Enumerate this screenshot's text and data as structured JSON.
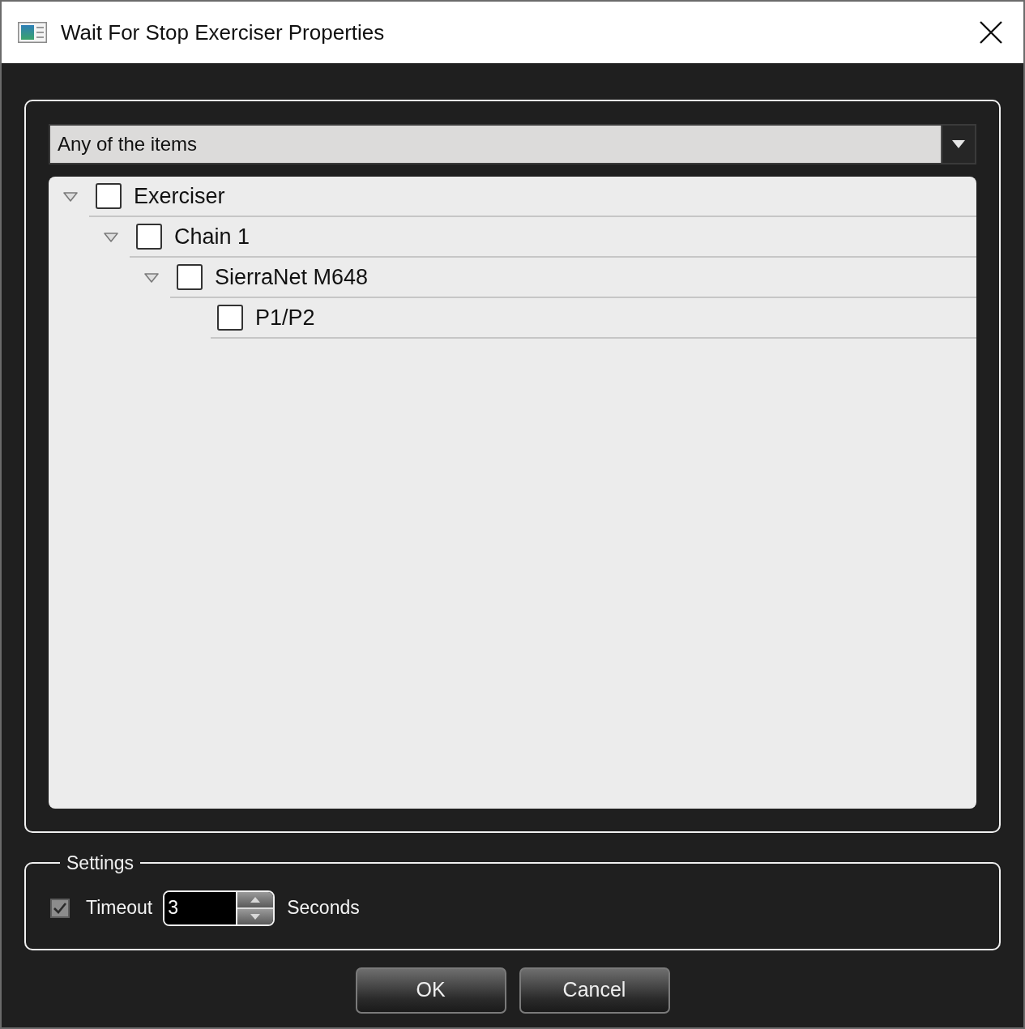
{
  "window": {
    "title": "Wait For Stop Exerciser Properties"
  },
  "mode_dropdown": {
    "value": "Any of the items"
  },
  "tree": {
    "items": [
      {
        "label": "Exerciser",
        "checked": false,
        "expanded": true,
        "children": [
          {
            "label": "Chain 1",
            "checked": false,
            "expanded": true,
            "children": [
              {
                "label": "SierraNet M648",
                "checked": false,
                "expanded": true,
                "children": [
                  {
                    "label": "P1/P2",
                    "checked": false
                  }
                ]
              }
            ]
          }
        ]
      }
    ]
  },
  "settings": {
    "title": "Settings",
    "timeout": {
      "label": "Timeout",
      "checked": true,
      "value": "3",
      "unit": "Seconds"
    }
  },
  "buttons": [
    {
      "label": "OK"
    },
    {
      "label": "Cancel"
    }
  ]
}
